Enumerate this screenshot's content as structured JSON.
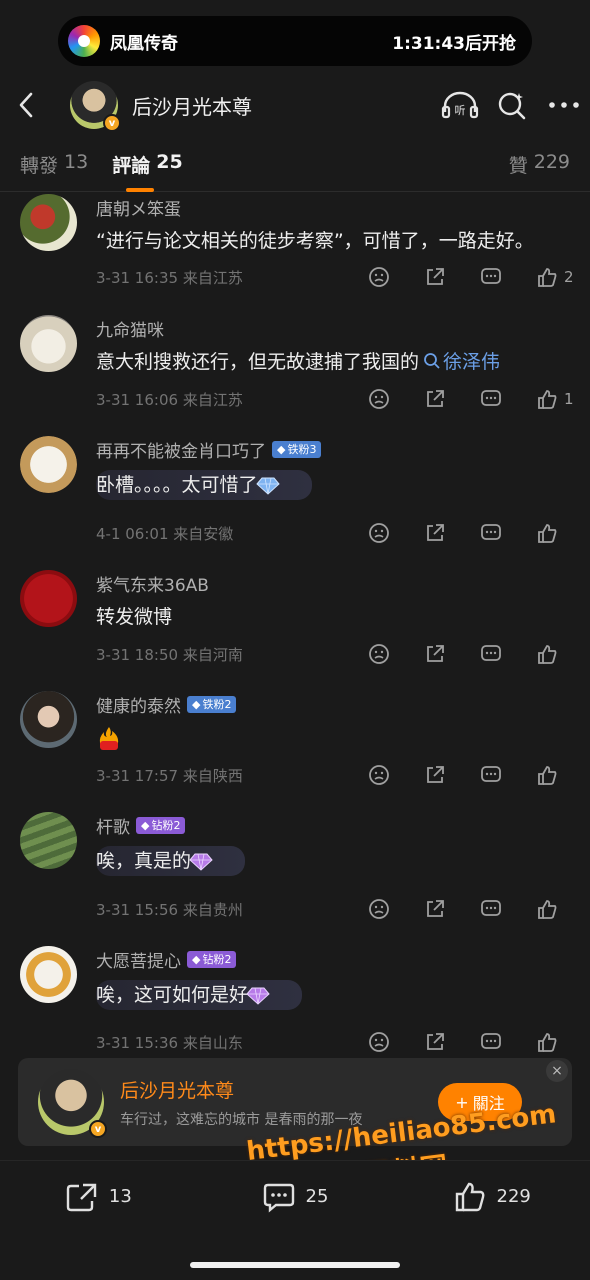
{
  "promo": {
    "app_name": "凤凰传奇",
    "timer": "1:31:43后开抢"
  },
  "header": {
    "title": "后沙月光本尊",
    "verified_mark": "v"
  },
  "tabs": [
    {
      "label": "轉發",
      "count": "13"
    },
    {
      "label": "評論",
      "count": "25"
    },
    {
      "label": "贊",
      "count": "229"
    }
  ],
  "comments": [
    {
      "name": "唐朝メ笨蛋",
      "text": "“进行与论文相关的徒步考察”，可惜了，一路走好。",
      "time": "3-31 16:35",
      "location": "来自江苏",
      "likes": "2"
    },
    {
      "name": "九命猫咪",
      "text": "意大利搜救还行，但无故逮捕了我国的",
      "link": "徐泽伟",
      "time": "3-31 16:06",
      "location": "来自江苏",
      "likes": "1"
    },
    {
      "name": "再再不能被金肖口巧了",
      "badge": "铁粉3",
      "text": "卧槽。。。。太可惜了",
      "time": "4-1 06:01",
      "location": "来自安徽"
    },
    {
      "name": "紫气东来36AB",
      "text": "转发微博",
      "time": "3-31 18:50",
      "location": "来自河南"
    },
    {
      "name": "健康的泰然",
      "badge": "铁粉2",
      "text": "",
      "time": "3-31 17:57",
      "location": "来自陕西"
    },
    {
      "name": "杆歌",
      "badge": "钻粉2",
      "text": "唉，真是的",
      "time": "3-31 15:56",
      "location": "来自贵州"
    },
    {
      "name": "大愿菩提心",
      "badge": "钻粉2",
      "text": "唉，这可如何是好",
      "time": "3-31 15:36",
      "location": "来自山东"
    }
  ],
  "follow_card": {
    "name": "后沙月光本尊",
    "subtitle": "车行过，这难忘的城市 是春雨的那一夜",
    "button": "關注"
  },
  "watermark": {
    "url": "https://heiliao85.com",
    "text": "黑料网"
  },
  "bottom_bar": {
    "repost": "13",
    "comment": "25",
    "like": "229"
  },
  "colors": {
    "accent": "#ff8200",
    "iron_badge": "#4a7fcf",
    "diamond_badge": "#8b5bd6",
    "link": "#6b9fe6"
  }
}
